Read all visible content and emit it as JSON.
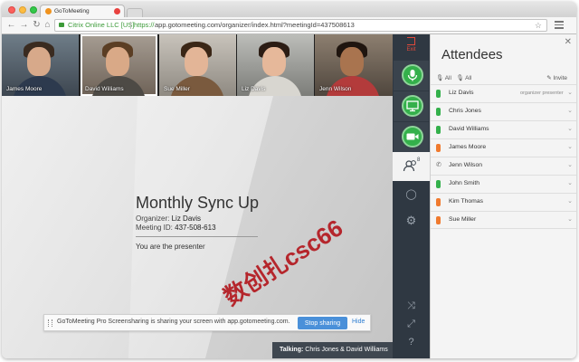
{
  "browser": {
    "tab_title": "GoToMeeting",
    "ev_label": "Citrix Online LLC [US]",
    "scheme": "https://",
    "url_rest": "app.gotomeeting.com/organizer/index.html?meetingId=437508613"
  },
  "thumbnails": [
    {
      "name": "James Moore"
    },
    {
      "name": "David Williams"
    },
    {
      "name": "Sue Miller"
    },
    {
      "name": "Liz Davis"
    },
    {
      "name": "Jenn Wilson"
    }
  ],
  "meeting": {
    "title": "Monthly Sync Up",
    "organizer_label": "Organizer:",
    "organizer_name": "Liz Davis",
    "id_label": "Meeting ID:",
    "id_value": "437-508-613",
    "presenter_text": "You are the presenter"
  },
  "share_bar": {
    "text": "GoToMeeting Pro Screensharing is sharing your screen with app.gotomeeting.com.",
    "stop_label": "Stop sharing",
    "hide_label": "Hide"
  },
  "talking": {
    "label": "Talking:",
    "names": "Chris Jones & David Williams"
  },
  "rail": {
    "exit_label": "Exit",
    "attendee_count": "8"
  },
  "attendees_panel": {
    "title": "Attendees",
    "filter_mic_all": "All",
    "filter_unmuted_all": "All",
    "invite_label": "Invite",
    "rows": [
      {
        "name": "Liz Davis",
        "role": "organizer presenter"
      },
      {
        "name": "Chris Jones",
        "role": ""
      },
      {
        "name": "David Williams",
        "role": ""
      },
      {
        "name": "James Moore",
        "role": ""
      },
      {
        "name": "Jenn Wilson",
        "role": ""
      },
      {
        "name": "John Smith",
        "role": ""
      },
      {
        "name": "Kim Thomas",
        "role": ""
      },
      {
        "name": "Sue Miller",
        "role": ""
      }
    ]
  },
  "watermark": "数创扎csc66",
  "colors": {
    "accent_green": "#34b04b",
    "mic_orange": "#f07a2e",
    "link_blue": "#2f7ed2",
    "exit_red": "#e24a3b"
  }
}
